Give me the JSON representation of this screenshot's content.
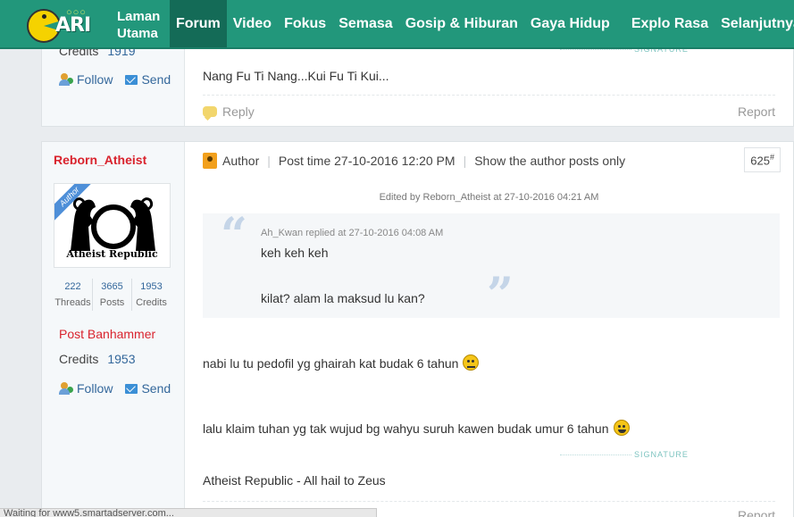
{
  "nav": {
    "home_line1": "Laman",
    "home_line2": "Utama",
    "items": [
      "Forum",
      "Video",
      "Fokus",
      "Semasa",
      "Gosip & Hiburan",
      "Gaya Hidup",
      "Explo Rasa",
      "Selanjutnya"
    ],
    "active": "Forum"
  },
  "post1": {
    "credits_label": "Credits",
    "credits_value": "1919",
    "follow_label": "Follow",
    "send_label": "Send",
    "signature_label": "SIGNATURE",
    "signature_text": "Nang Fu Ti Nang...Kui Fu Ti Kui...",
    "reply_label": "Reply",
    "report_label": "Report"
  },
  "post2": {
    "username": "Reborn_Atheist",
    "avatar_ribbon": "Author",
    "avatar_caption": "Atheist Republic",
    "stats": [
      {
        "num": "222",
        "label": "Threads"
      },
      {
        "num": "3665",
        "label": "Posts"
      },
      {
        "num": "1953",
        "label": "Credits"
      }
    ],
    "rank": "Post Banhammer",
    "credits_label": "Credits",
    "credits_value": "1953",
    "follow_label": "Follow",
    "send_label": "Send",
    "author_label": "Author",
    "post_time": "Post time 27-10-2016 12:20 PM",
    "show_author_only": "Show the author posts only",
    "floor": "625",
    "floor_mark": "#",
    "edited": "Edited by Reborn_Atheist at 27-10-2016 04:21 AM",
    "quote": {
      "head": "Ah_Kwan replied at 27-10-2016 04:08 AM",
      "line1": "keh keh keh",
      "line2": "kilat? alam la maksud lu kan?"
    },
    "body_line1": "nabi lu tu pedofil yg ghairah kat budak 6 tahun",
    "body_line2": "lalu klaim tuhan yg tak wujud bg wahyu suruh kawen budak umur 6 tahun",
    "signature_label": "SIGNATURE",
    "signature_text": "Atheist Republic - All hail to Zeus",
    "report_label": "Report"
  },
  "statusbar": "Waiting for www5.smartadserver.com..."
}
